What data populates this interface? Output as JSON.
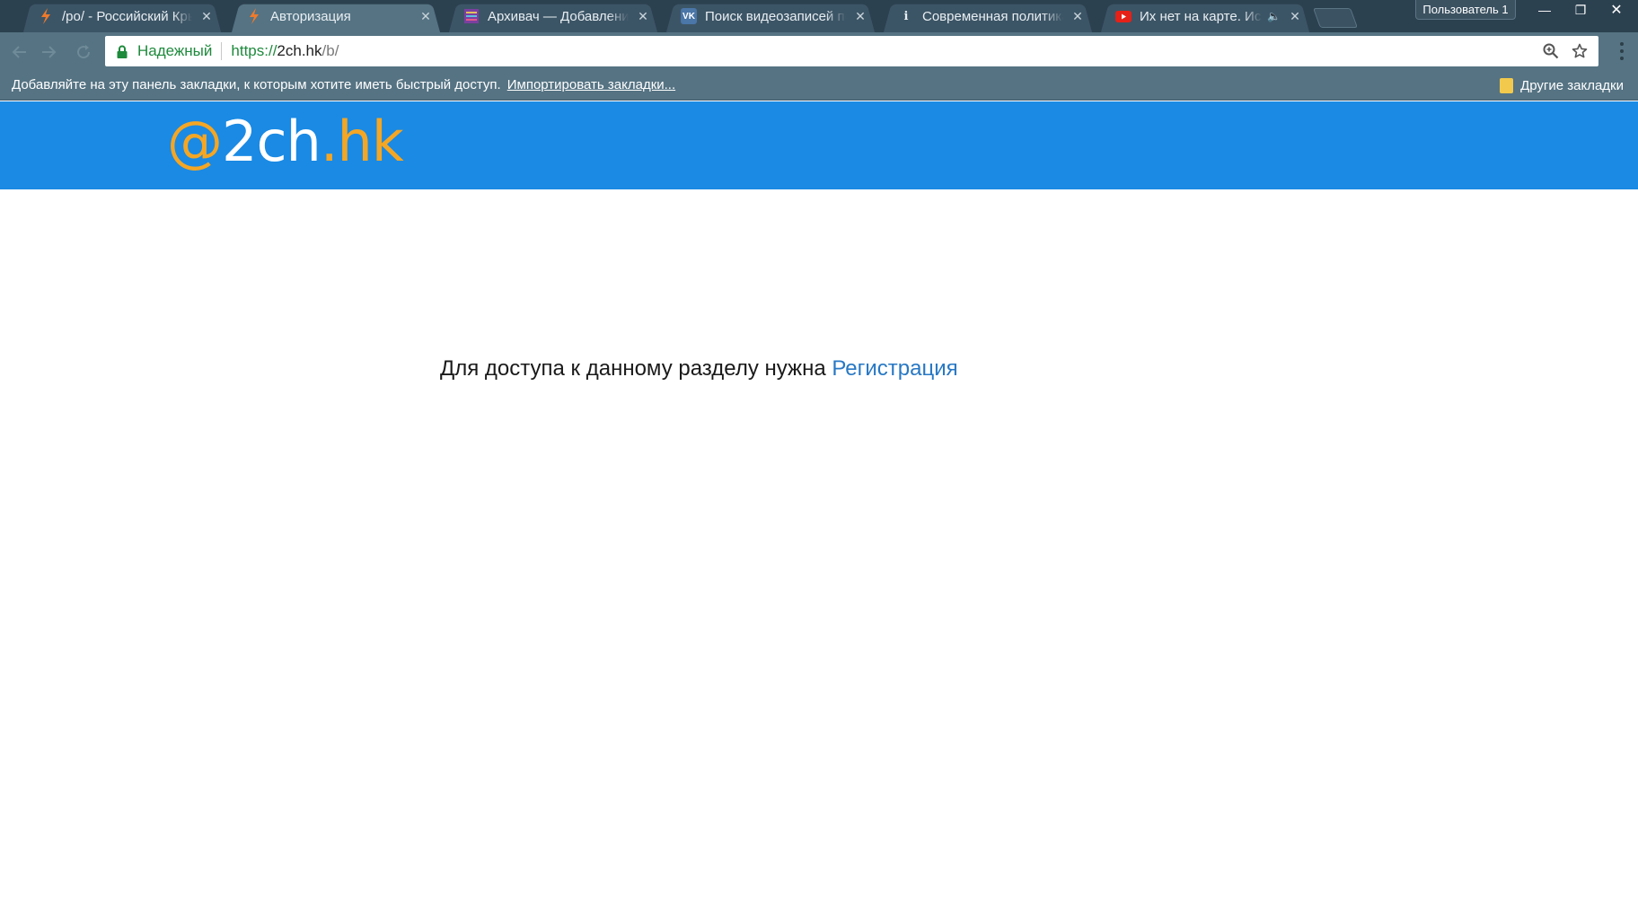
{
  "tabs": [
    {
      "title": "/po/ - Российский Крым",
      "favicon": "lightning-icon",
      "favicon_color": "#f07a2a",
      "active": false
    },
    {
      "title": "Авторизация",
      "favicon": "lightning-icon",
      "favicon_color": "#f07a2a",
      "active": true
    },
    {
      "title": "Архивач — Добавление",
      "favicon": "archive-icon",
      "favicon_color": "#7b3fa0",
      "active": false
    },
    {
      "title": "Поиск видеозаписей по",
      "favicon": "vk-icon",
      "favicon_color": "#4a76a8",
      "active": false
    },
    {
      "title": "Современная политика",
      "favicon": "info-icon",
      "favicon_color": "#3b3b8f",
      "active": false
    },
    {
      "title": "Их нет на карте. Исто",
      "favicon": "youtube-icon",
      "favicon_color": "#e62117",
      "active": false,
      "audio": true
    }
  ],
  "window": {
    "profile_name": "Пользователь 1",
    "minimize_glyph": "—",
    "maximize_glyph": "❐",
    "close_glyph": "✕"
  },
  "toolbar": {
    "secure_label": "Надежный",
    "url_scheme": "https://",
    "url_host": "2ch.hk",
    "url_path": "/b/"
  },
  "bookmarks": {
    "hint": "Добавляйте на эту панель закладки, к которым хотите иметь быстрый доступ.",
    "import_link": "Импортировать закладки...",
    "other": "Другие закладки"
  },
  "site": {
    "logo_at": "@",
    "logo_name": "2ch",
    "logo_tld": ".hk",
    "header_color": "#1a8ae4",
    "accent_color": "#f5a623"
  },
  "content": {
    "message": "Для доступа к данному разделу нужна ",
    "link": "Регистрация"
  }
}
